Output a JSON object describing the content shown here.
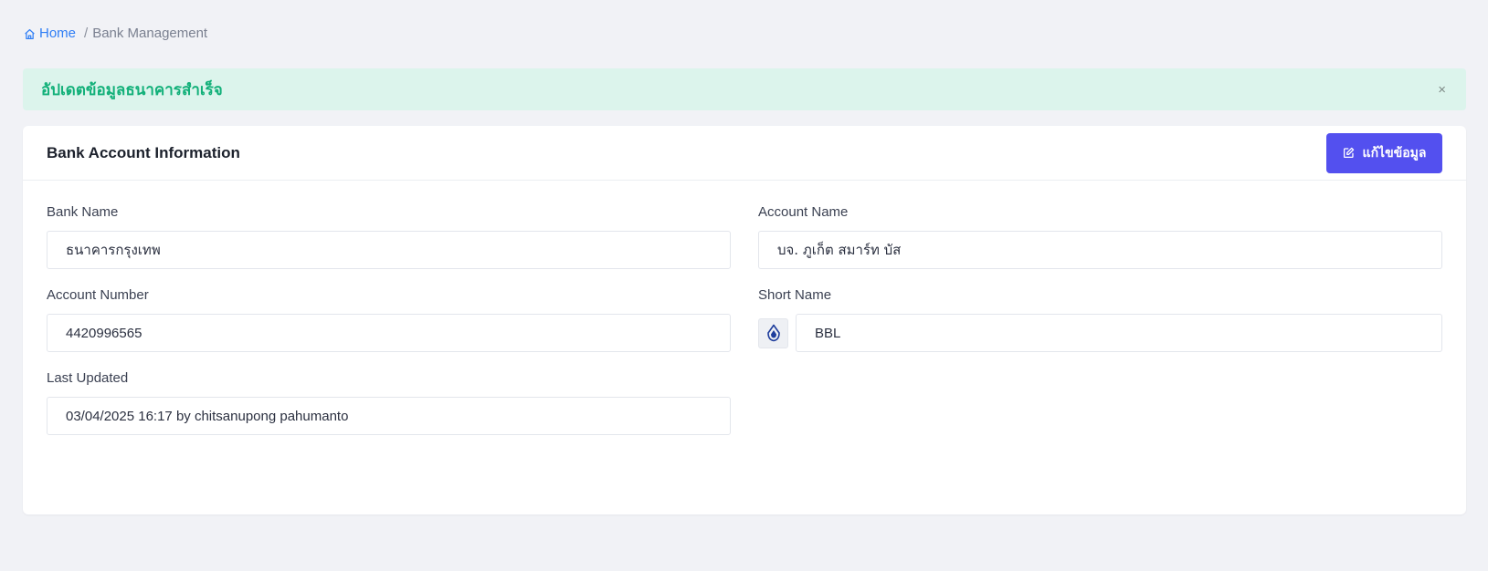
{
  "breadcrumb": {
    "home_label": "Home",
    "separator": "/",
    "current": "Bank Management"
  },
  "alert": {
    "message": "อัปเดตข้อมูลธนาคารสำเร็จ",
    "close_symbol": "×",
    "status": "success",
    "color": "#12b079"
  },
  "card": {
    "title": "Bank Account Information",
    "edit_button_label": "แก้ไขข้อมูล",
    "edit_button_color": "#5350ef"
  },
  "fields": {
    "bank_name": {
      "label": "Bank Name",
      "value": "ธนาคารกรุงเทพ"
    },
    "account_name": {
      "label": "Account Name",
      "value": "บจ. ภูเก็ต สมาร์ท บัส"
    },
    "account_number": {
      "label": "Account Number",
      "value": "4420996565"
    },
    "short_name": {
      "label": "Short Name",
      "value": "BBL",
      "logo_icon": "bangkok-bank-logo-icon"
    },
    "last_updated": {
      "label": "Last Updated",
      "value": "03/04/2025 16:17 by chitsanupong pahumanto"
    }
  },
  "icons": {
    "home": "home-icon",
    "edit": "edit-icon",
    "close": "close-icon"
  }
}
